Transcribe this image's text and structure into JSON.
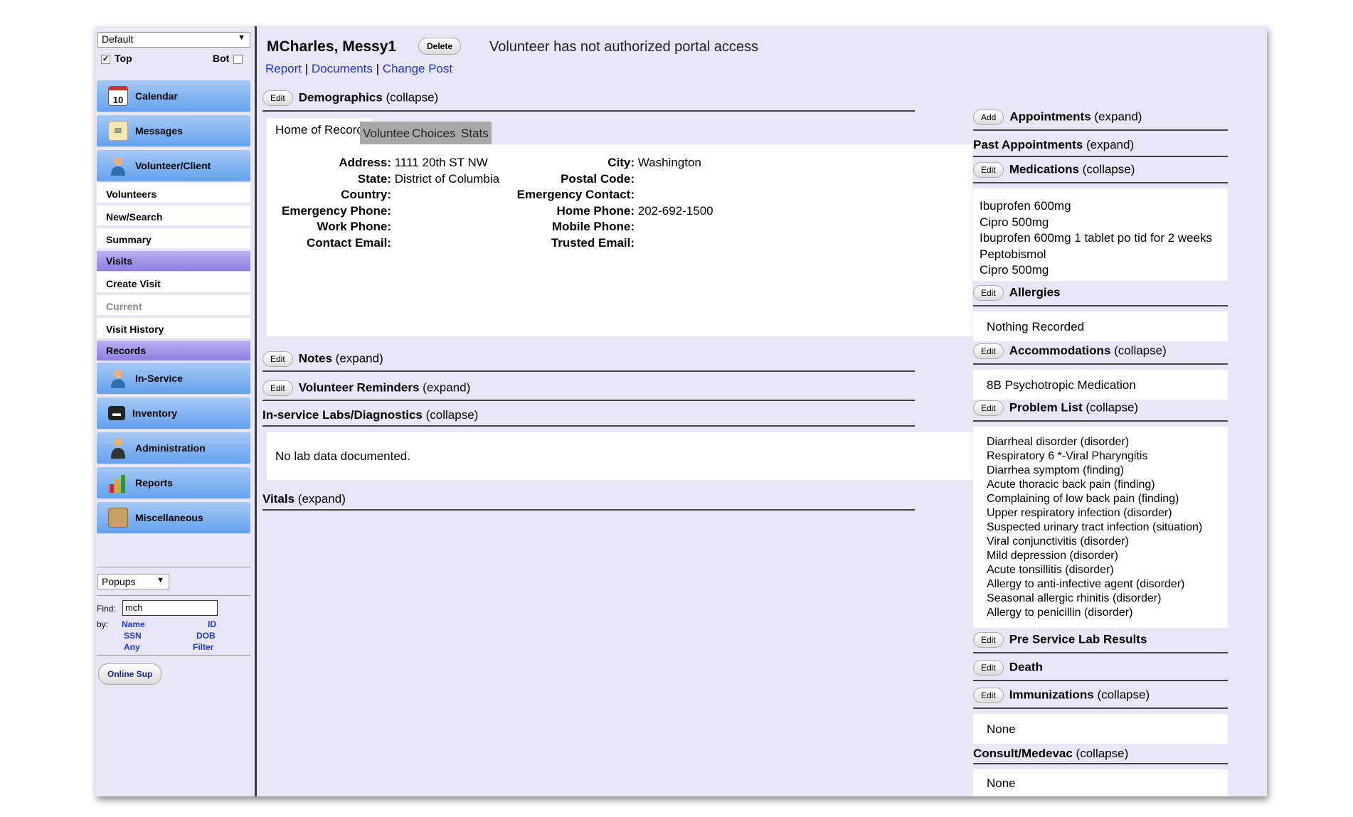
{
  "sidebar": {
    "view_select": "Default",
    "top_label": "Top",
    "top_checked": true,
    "bot_label": "Bot",
    "bot_checked": false,
    "nav": {
      "calendar": "Calendar",
      "calendar_icon_day": "10",
      "messages": "Messages",
      "volunteer_client": "Volunteer/Client",
      "volunteers": "Volunteers",
      "new_search": "New/Search",
      "summary": "Summary",
      "visits_header": "Visits",
      "create_visit": "Create Visit",
      "current": "Current",
      "visit_history": "Visit History",
      "records_header": "Records",
      "in_service": "In-Service",
      "inventory": "Inventory",
      "administration": "Administration",
      "reports": "Reports",
      "miscellaneous": "Miscellaneous"
    },
    "popups_select": "Popups",
    "find_label": "Find:",
    "find_value": "mch",
    "by_label": "by:",
    "by_links": {
      "name": "Name",
      "id": "ID",
      "ssn": "SSN",
      "dob": "DOB",
      "any": "Any",
      "filter": "Filter"
    },
    "online_support": "Online Sup"
  },
  "header": {
    "patient_name": "MCharles, Messy1",
    "delete_label": "Delete",
    "portal_status": "Volunteer has not authorized portal access",
    "links": {
      "report": "Report",
      "documents": "Documents",
      "change_post": "Change Post",
      "separator": "|"
    }
  },
  "demographics": {
    "edit_label": "Edit",
    "title": "Demographics",
    "toggle": "(collapse)",
    "tabs": [
      "Home of Record",
      "Volunteer",
      "Choices",
      "Stats"
    ],
    "left_fields": [
      {
        "label": "Address:",
        "value": "1111 20th ST NW"
      },
      {
        "label": "State:",
        "value": "District of Columbia"
      },
      {
        "label": "Country:",
        "value": ""
      },
      {
        "label": "Emergency Phone:",
        "value": ""
      },
      {
        "label": "Work Phone:",
        "value": ""
      },
      {
        "label": "Contact Email:",
        "value": ""
      }
    ],
    "right_fields": [
      {
        "label": "City:",
        "value": "Washington"
      },
      {
        "label": "Postal Code:",
        "value": ""
      },
      {
        "label": "Emergency Contact:",
        "value": ""
      },
      {
        "label": "Home Phone:",
        "value": "202-692-1500"
      },
      {
        "label": "Mobile Phone:",
        "value": ""
      },
      {
        "label": "Trusted Email:",
        "value": ""
      }
    ]
  },
  "notes": {
    "edit_label": "Edit",
    "title": "Notes",
    "toggle": "(expand)"
  },
  "reminders": {
    "edit_label": "Edit",
    "title": "Volunteer Reminders",
    "toggle": "(expand)"
  },
  "labs": {
    "title": "In-service Labs/Diagnostics",
    "toggle": "(collapse)",
    "content": "No lab data documented."
  },
  "vitals": {
    "title": "Vitals",
    "toggle": "(expand)"
  },
  "right": {
    "appointments": {
      "btn": "Add",
      "title": "Appointments",
      "toggle": "(expand)"
    },
    "past_appointments": {
      "title": "Past Appointments",
      "toggle": "(expand)"
    },
    "medications": {
      "btn": "Edit",
      "title": "Medications",
      "toggle": "(collapse)",
      "items": [
        "Ibuprofen 600mg",
        "Cipro 500mg",
        "Ibuprofen 600mg 1 tablet po tid for 2 weeks",
        "Peptobismol",
        "Cipro 500mg"
      ]
    },
    "allergies": {
      "btn": "Edit",
      "title": "Allergies",
      "content": "Nothing Recorded"
    },
    "accommodations": {
      "btn": "Edit",
      "title": "Accommodations",
      "toggle": "(collapse)",
      "content": "8B Psychotropic Medication"
    },
    "problem_list": {
      "btn": "Edit",
      "title": "Problem List",
      "toggle": "(collapse)",
      "items": [
        "Diarrheal disorder (disorder)",
        "Respiratory 6 *-Viral Pharyngitis",
        "Diarrhea symptom (finding)",
        "Acute thoracic back pain (finding)",
        "Complaining of low back pain (finding)",
        "Upper respiratory infection (disorder)",
        "Suspected urinary tract infection (situation)",
        "Viral conjunctivitis (disorder)",
        "Mild depression (disorder)",
        "Acute tonsillitis (disorder)",
        "Allergy to anti-infective agent (disorder)",
        "Seasonal allergic rhinitis (disorder)",
        "Allergy to penicillin (disorder)"
      ]
    },
    "pre_service_labs": {
      "btn": "Edit",
      "title": "Pre Service Lab Results"
    },
    "death": {
      "btn": "Edit",
      "title": "Death"
    },
    "immunizations": {
      "btn": "Edit",
      "title": "Immunizations",
      "toggle": "(collapse)",
      "content": "None"
    },
    "consult": {
      "title": "Consult/Medevac",
      "toggle": "(collapse)",
      "content": "None"
    }
  }
}
